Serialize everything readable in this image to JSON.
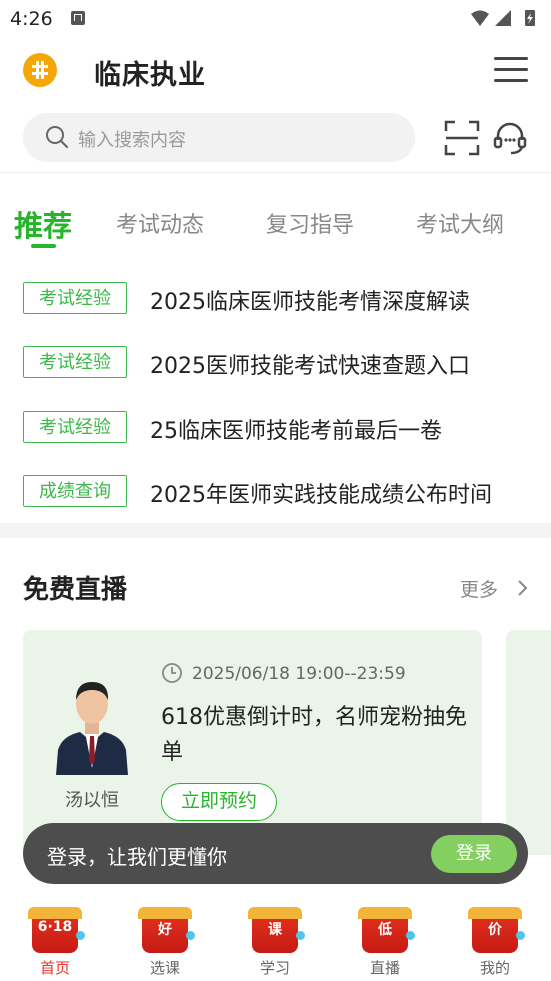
{
  "status_bar": {
    "time": "4:26"
  },
  "header": {
    "title": "临床执业",
    "logo_icon": "plus-logo-icon",
    "menu_icon": "hamburger-menu-icon"
  },
  "search": {
    "placeholder": "输入搜索内容",
    "scan_icon": "scan-icon",
    "service_icon": "headset-icon"
  },
  "tabs": [
    {
      "label": "推荐",
      "active": true
    },
    {
      "label": "考试动态",
      "active": false
    },
    {
      "label": "复习指导",
      "active": false
    },
    {
      "label": "考试大纲",
      "active": false
    }
  ],
  "news": [
    {
      "tag": "考试经验",
      "title": "2025临床医师技能考情深度解读"
    },
    {
      "tag": "考试经验",
      "title": "2025医师技能考试快速查题入口"
    },
    {
      "tag": "考试经验",
      "title": "25临床医师技能考前最后一卷"
    },
    {
      "tag": "成绩查询",
      "title": "2025年医师实践技能成绩公布时间"
    }
  ],
  "live": {
    "heading": "免费直播",
    "more_label": "更多",
    "card": {
      "teacher_name": "汤以恒",
      "time": "2025/06/18 19:00--23:59",
      "title": "618优惠倒计时，名师宠粉抽免单",
      "button_label": "立即预约"
    }
  },
  "login_prompt": {
    "text": "登录，让我们更懂你",
    "button_label": "登录"
  },
  "bottom_nav": [
    {
      "badge": "6·18",
      "label": "首页",
      "active": true
    },
    {
      "badge": "好",
      "label": "选课",
      "active": false
    },
    {
      "badge": "课",
      "label": "学习",
      "active": false
    },
    {
      "badge": "低",
      "label": "直播",
      "active": false
    },
    {
      "badge": "价",
      "label": "我的",
      "active": false
    }
  ],
  "colors": {
    "brand_green": "#27b52b",
    "tag_green": "#3cb84a",
    "nav_active": "#e8332a",
    "logo_orange": "#f5a70a"
  }
}
